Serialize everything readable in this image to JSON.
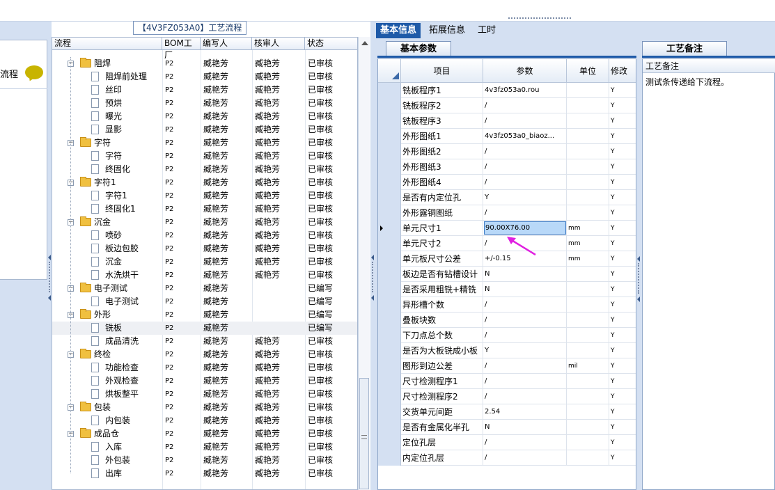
{
  "left_panel": {
    "label": "流程"
  },
  "process_panel": {
    "title": "【4V3FZ053A0】工艺流程",
    "columns": [
      "流程",
      "BOM工厂",
      "编写人",
      "核审人",
      "状态"
    ],
    "rows": [
      {
        "level": 0,
        "type": "folder",
        "name": "阻焊",
        "bom": "P2",
        "editor": "臧艳芳",
        "reviewer": "臧艳芳",
        "status": "已审核"
      },
      {
        "level": 1,
        "type": "doc",
        "name": "阻焊前处理",
        "bom": "P2",
        "editor": "臧艳芳",
        "reviewer": "臧艳芳",
        "status": "已审核"
      },
      {
        "level": 1,
        "type": "doc",
        "name": "丝印",
        "bom": "P2",
        "editor": "臧艳芳",
        "reviewer": "臧艳芳",
        "status": "已审核"
      },
      {
        "level": 1,
        "type": "doc",
        "name": "预烘",
        "bom": "P2",
        "editor": "臧艳芳",
        "reviewer": "臧艳芳",
        "status": "已审核"
      },
      {
        "level": 1,
        "type": "doc",
        "name": "曝光",
        "bom": "P2",
        "editor": "臧艳芳",
        "reviewer": "臧艳芳",
        "status": "已审核"
      },
      {
        "level": 1,
        "type": "doc",
        "name": "显影",
        "bom": "P2",
        "editor": "臧艳芳",
        "reviewer": "臧艳芳",
        "status": "已审核"
      },
      {
        "level": 0,
        "type": "folder",
        "name": "字符",
        "bom": "P2",
        "editor": "臧艳芳",
        "reviewer": "臧艳芳",
        "status": "已审核"
      },
      {
        "level": 1,
        "type": "doc",
        "name": "字符",
        "bom": "P2",
        "editor": "臧艳芳",
        "reviewer": "臧艳芳",
        "status": "已审核"
      },
      {
        "level": 1,
        "type": "doc",
        "name": "终固化",
        "bom": "P2",
        "editor": "臧艳芳",
        "reviewer": "臧艳芳",
        "status": "已审核"
      },
      {
        "level": 0,
        "type": "folder",
        "name": "字符1",
        "bom": "P2",
        "editor": "臧艳芳",
        "reviewer": "臧艳芳",
        "status": "已审核"
      },
      {
        "level": 1,
        "type": "doc",
        "name": "字符1",
        "bom": "P2",
        "editor": "臧艳芳",
        "reviewer": "臧艳芳",
        "status": "已审核"
      },
      {
        "level": 1,
        "type": "doc",
        "name": "终固化1",
        "bom": "P2",
        "editor": "臧艳芳",
        "reviewer": "臧艳芳",
        "status": "已审核"
      },
      {
        "level": 0,
        "type": "folder",
        "name": "沉金",
        "bom": "P2",
        "editor": "臧艳芳",
        "reviewer": "臧艳芳",
        "status": "已审核"
      },
      {
        "level": 1,
        "type": "doc",
        "name": "喷砂",
        "bom": "P2",
        "editor": "臧艳芳",
        "reviewer": "臧艳芳",
        "status": "已审核"
      },
      {
        "level": 1,
        "type": "doc",
        "name": "板边包胶",
        "bom": "P2",
        "editor": "臧艳芳",
        "reviewer": "臧艳芳",
        "status": "已审核"
      },
      {
        "level": 1,
        "type": "doc",
        "name": "沉金",
        "bom": "P2",
        "editor": "臧艳芳",
        "reviewer": "臧艳芳",
        "status": "已审核"
      },
      {
        "level": 1,
        "type": "doc",
        "name": "水洗烘干",
        "bom": "P2",
        "editor": "臧艳芳",
        "reviewer": "臧艳芳",
        "status": "已审核"
      },
      {
        "level": 0,
        "type": "folder",
        "name": "电子测试",
        "bom": "P2",
        "editor": "臧艳芳",
        "reviewer": "",
        "status": "已编写"
      },
      {
        "level": 1,
        "type": "doc",
        "name": "电子测试",
        "bom": "P2",
        "editor": "臧艳芳",
        "reviewer": "",
        "status": "已编写"
      },
      {
        "level": 0,
        "type": "folder",
        "name": "外形",
        "bom": "P2",
        "editor": "臧艳芳",
        "reviewer": "",
        "status": "已编写"
      },
      {
        "level": 1,
        "type": "doc",
        "name": "铣板",
        "bom": "P2",
        "editor": "臧艳芳",
        "reviewer": "",
        "status": "已编写",
        "selected": true
      },
      {
        "level": 1,
        "type": "doc",
        "name": "成品清洗",
        "bom": "P2",
        "editor": "臧艳芳",
        "reviewer": "臧艳芳",
        "status": "已审核"
      },
      {
        "level": 0,
        "type": "folder",
        "name": "终检",
        "bom": "P2",
        "editor": "臧艳芳",
        "reviewer": "臧艳芳",
        "status": "已审核"
      },
      {
        "level": 1,
        "type": "doc",
        "name": "功能检查",
        "bom": "P2",
        "editor": "臧艳芳",
        "reviewer": "臧艳芳",
        "status": "已审核"
      },
      {
        "level": 1,
        "type": "doc",
        "name": "外观检查",
        "bom": "P2",
        "editor": "臧艳芳",
        "reviewer": "臧艳芳",
        "status": "已审核"
      },
      {
        "level": 1,
        "type": "doc",
        "name": "烘板整平",
        "bom": "P2",
        "editor": "臧艳芳",
        "reviewer": "臧艳芳",
        "status": "已审核"
      },
      {
        "level": 0,
        "type": "folder",
        "name": "包装",
        "bom": "P2",
        "editor": "臧艳芳",
        "reviewer": "臧艳芳",
        "status": "已审核"
      },
      {
        "level": 1,
        "type": "doc",
        "name": "内包装",
        "bom": "P2",
        "editor": "臧艳芳",
        "reviewer": "臧艳芳",
        "status": "已审核"
      },
      {
        "level": 0,
        "type": "folder",
        "name": "成品仓",
        "bom": "P2",
        "editor": "臧艳芳",
        "reviewer": "臧艳芳",
        "status": "已审核"
      },
      {
        "level": 1,
        "type": "doc",
        "name": "入库",
        "bom": "P2",
        "editor": "臧艳芳",
        "reviewer": "臧艳芳",
        "status": "已审核"
      },
      {
        "level": 1,
        "type": "doc",
        "name": "外包装",
        "bom": "P2",
        "editor": "臧艳芳",
        "reviewer": "臧艳芳",
        "status": "已审核"
      },
      {
        "level": 1,
        "type": "doc",
        "name": "出库",
        "bom": "P2",
        "editor": "臧艳芳",
        "reviewer": "臧艳芳",
        "status": "已审核"
      }
    ]
  },
  "right_panel": {
    "tabs": [
      "基本信息",
      "拓展信息",
      "工时"
    ],
    "active_tab": "基本信息",
    "subtab": "基本参数",
    "columns": [
      "项目",
      "参数",
      "单位",
      "修改"
    ],
    "rows": [
      {
        "item": "铣板程序1",
        "param": "4v3fz053a0.rou",
        "unit": "",
        "mod": "Y"
      },
      {
        "item": "铣板程序2",
        "param": "/",
        "unit": "",
        "mod": "Y"
      },
      {
        "item": "铣板程序3",
        "param": "/",
        "unit": "",
        "mod": "Y"
      },
      {
        "item": "外形图纸1",
        "param": "4v3fz053a0_biaoz...",
        "unit": "",
        "mod": "Y"
      },
      {
        "item": "外形图纸2",
        "param": "/",
        "unit": "",
        "mod": "Y"
      },
      {
        "item": "外形图纸3",
        "param": "/",
        "unit": "",
        "mod": "Y"
      },
      {
        "item": "外形图纸4",
        "param": "/",
        "unit": "",
        "mod": "Y"
      },
      {
        "item": "是否有内定位孔",
        "param": "Y",
        "unit": "",
        "mod": "Y"
      },
      {
        "item": "外形露铜图纸",
        "param": "/",
        "unit": "",
        "mod": "Y"
      },
      {
        "item": "单元尺寸1",
        "param": "90.00X76.00",
        "unit": "mm",
        "mod": "Y",
        "editing": true
      },
      {
        "item": "单元尺寸2",
        "param": "/",
        "unit": "mm",
        "mod": "Y"
      },
      {
        "item": "单元板尺寸公差",
        "param": "+/-0.15",
        "unit": "mm",
        "mod": "Y"
      },
      {
        "item": "板边是否有钻槽设计",
        "param": "N",
        "unit": "",
        "mod": "Y"
      },
      {
        "item": "是否采用粗铣+精铣",
        "param": "N",
        "unit": "",
        "mod": "Y"
      },
      {
        "item": "异形槽个数",
        "param": "/",
        "unit": "",
        "mod": "Y"
      },
      {
        "item": "叠板块数",
        "param": "/",
        "unit": "",
        "mod": "Y"
      },
      {
        "item": "下刀点总个数",
        "param": "/",
        "unit": "",
        "mod": "Y"
      },
      {
        "item": "是否为大板铣成小板",
        "param": "Y",
        "unit": "",
        "mod": "Y"
      },
      {
        "item": "图形到边公差",
        "param": "/",
        "unit": "mil",
        "mod": "Y"
      },
      {
        "item": "尺寸检测程序1",
        "param": "/",
        "unit": "",
        "mod": "Y"
      },
      {
        "item": "尺寸检测程序2",
        "param": "/",
        "unit": "",
        "mod": "Y"
      },
      {
        "item": "交货单元间距",
        "param": "2.54",
        "unit": "",
        "mod": "Y"
      },
      {
        "item": "是否有金属化半孔",
        "param": "N",
        "unit": "",
        "mod": "Y"
      },
      {
        "item": "定位孔层",
        "param": "/",
        "unit": "",
        "mod": "Y"
      },
      {
        "item": "内定位孔层",
        "param": "/",
        "unit": "",
        "mod": "Y"
      }
    ]
  },
  "notes_panel": {
    "tab": "工艺备注",
    "header": "工艺备注",
    "text": "测试条传递给下流程。"
  },
  "colors": {
    "accent": "#1e5aa8",
    "panel_bg": "#d4e0f2",
    "annotation": "#e020e0"
  }
}
